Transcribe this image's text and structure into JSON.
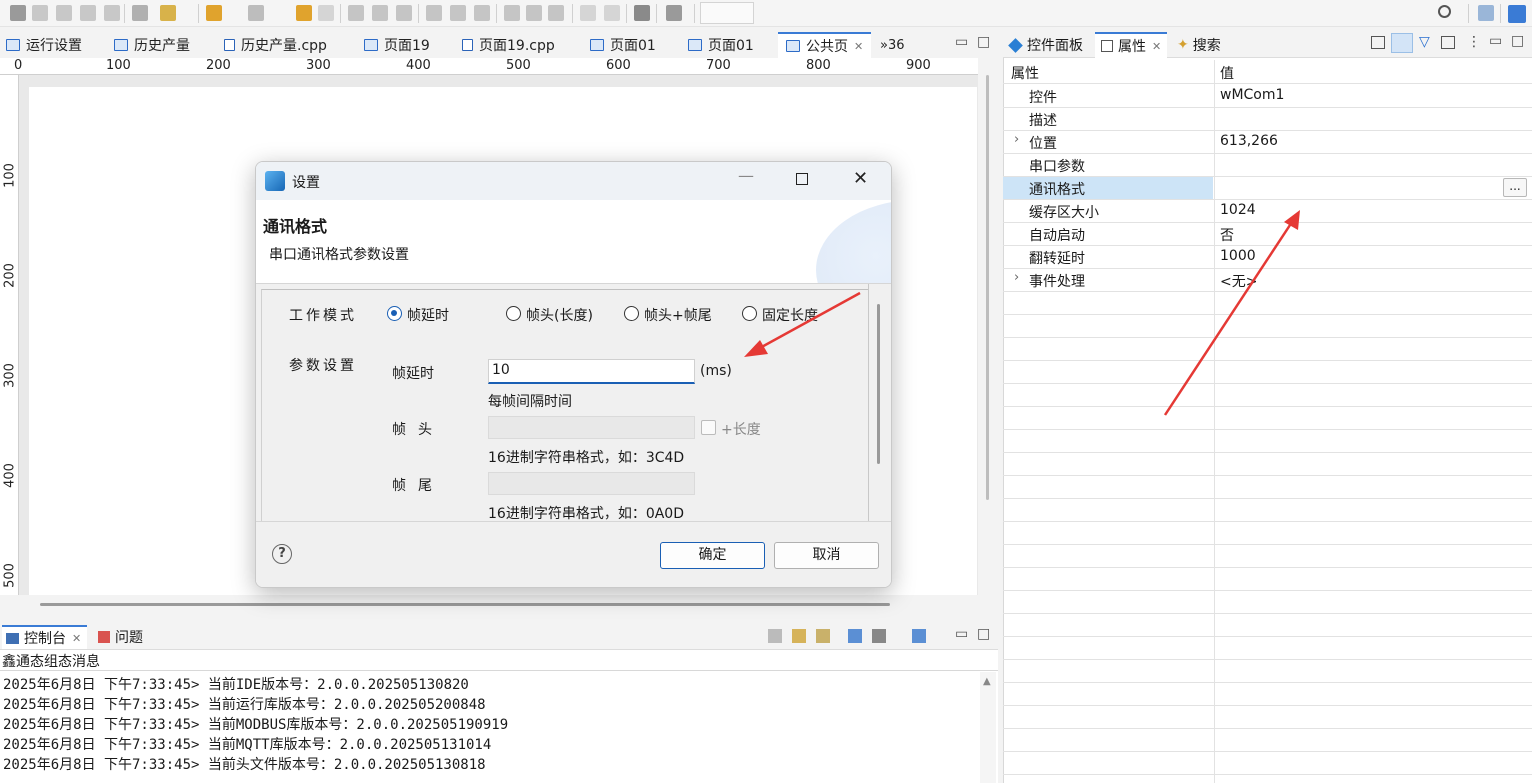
{
  "editor_tabs": [
    {
      "label": "运行设置"
    },
    {
      "label": "历史产量"
    },
    {
      "label": "历史产量.cpp"
    },
    {
      "label": "页面19"
    },
    {
      "label": "页面19.cpp"
    },
    {
      "label": "页面01"
    },
    {
      "label": "页面01"
    },
    {
      "label": "公共页"
    },
    {
      "label": "»36"
    }
  ],
  "ruler": {
    "h_ticks": [
      "0",
      "100",
      "200",
      "300",
      "400",
      "500",
      "600",
      "700",
      "800",
      "900"
    ],
    "v_ticks": [
      "100",
      "200",
      "300",
      "400",
      "500"
    ]
  },
  "right_panel": {
    "tabs": [
      {
        "label": "控件面板"
      },
      {
        "label": "属性"
      },
      {
        "label": "搜索"
      }
    ],
    "header": {
      "key": "属性",
      "value": "值"
    },
    "rows": [
      {
        "key": "控件",
        "value": "wMCom1"
      },
      {
        "key": "描述",
        "value": ""
      },
      {
        "key": "位置",
        "value": "613,266",
        "expandable": true
      },
      {
        "key": "串口参数",
        "value": ""
      },
      {
        "key": "通讯格式",
        "value": "",
        "selected": true
      },
      {
        "key": "缓存区大小",
        "value": "1024"
      },
      {
        "key": "自动启动",
        "value": "否"
      },
      {
        "key": "翻转延时",
        "value": "1000"
      },
      {
        "key": "事件处理",
        "value": "<无>",
        "expandable": true
      }
    ],
    "dots_button": "..."
  },
  "dialog": {
    "title": "设置",
    "heading": "通讯格式",
    "subheading": "串口通讯格式参数设置",
    "work_mode_label": "工作模式",
    "modes": [
      "帧延时",
      "帧头(长度)",
      "帧头+帧尾",
      "固定长度"
    ],
    "selected_mode": "帧延时",
    "param_label": "参数设置",
    "frame_delay_label": "帧延时",
    "frame_delay_value": "10",
    "frame_delay_unit": "(ms)",
    "frame_delay_hint": "每帧间隔时间",
    "frame_head_label": "帧头",
    "plus_length_label": "+长度",
    "frame_head_hint": "16进制字符串格式，如：3C4D",
    "frame_tail_label": "帧尾",
    "frame_tail_hint": "16进制字符串格式，如：0A0D",
    "help": "?",
    "ok_label": "确定",
    "cancel_label": "取消"
  },
  "console": {
    "tabs": [
      {
        "label": "控制台"
      },
      {
        "label": "问题"
      }
    ],
    "header": "鑫通态组态消息",
    "lines": [
      "2025年6月8日 下午7:33:45> 当前IDE版本号：2.0.0.202505130820",
      "2025年6月8日 下午7:33:45> 当前运行库版本号：2.0.0.202505200848",
      "2025年6月8日 下午7:33:45> 当前MODBUS库版本号：2.0.0.202505190919",
      "2025年6月8日 下午7:33:45> 当前MQTT库版本号：2.0.0.202505131014",
      "2025年6月8日 下午7:33:45> 当前头文件版本号：2.0.0.202505130818"
    ]
  },
  "colors": {
    "accent": "#1a5fb4",
    "arrow": "#e53935",
    "selection": "#cde4f7"
  }
}
